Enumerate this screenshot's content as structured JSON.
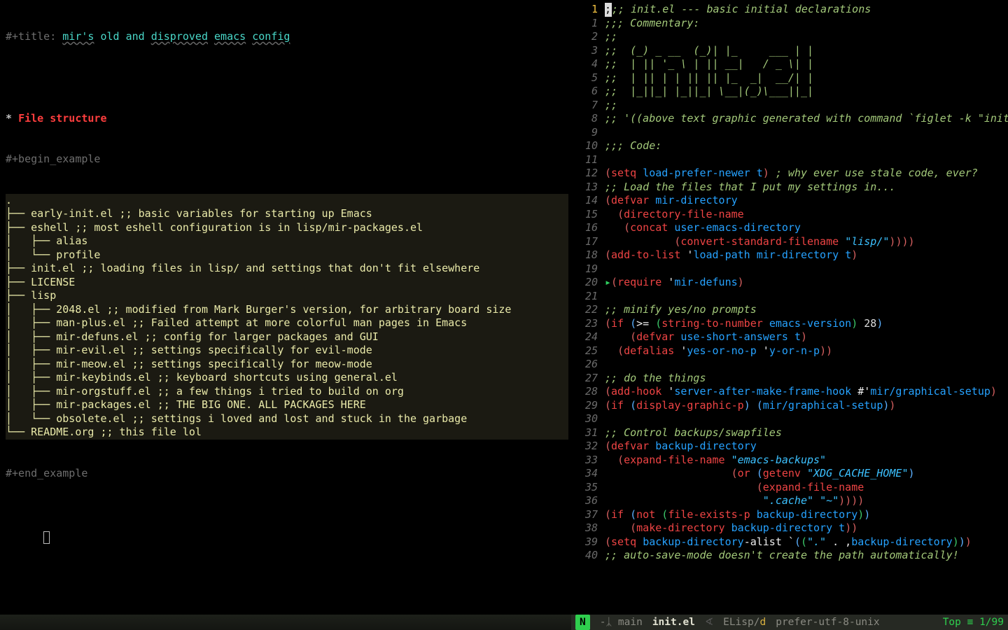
{
  "left": {
    "title_prefix": "#+title: ",
    "title_words": [
      "mir's",
      "old",
      "and",
      "disproved",
      "emacs",
      "config"
    ],
    "heading_star": "* ",
    "heading_text": "File structure",
    "begin_example": "#+begin_example",
    "end_example": "#+end_example",
    "tree": [
      ".",
      "├── early-init.el ;; basic variables for starting up Emacs",
      "├── eshell ;; most eshell configuration is in lisp/mir-packages.el",
      "│   ├── alias",
      "│   └── profile",
      "├── init.el ;; loading files in lisp/ and settings that don't fit elsewhere",
      "├── LICENSE",
      "├── lisp",
      "│   ├── 2048.el ;; modified from Mark Burger's version, for arbitrary board size",
      "│   ├── man-plus.el ;; Failed attempt at more colorful man pages in Emacs",
      "│   ├── mir-defuns.el ;; config for larger packages and GUI",
      "│   ├── mir-evil.el ;; settings specifically for evil-mode",
      "│   ├── mir-meow.el ;; settings specifically for meow-mode",
      "│   ├── mir-keybinds.el ;; keyboard shortcuts using general.el",
      "│   ├── mir-orgstuff.el ;; a few things i tried to build on org",
      "│   ├── mir-packages.el ;; THE BIG ONE. ALL PACKAGES HERE",
      "│   └── obsolete.el ;; settings i loved and lost and stuck in the garbage",
      "└── README.org ;; this file lol"
    ]
  },
  "right": {
    "current_line_indicator": "1",
    "lines": [
      {
        "n": 1,
        "raw": ";;; init.el --- basic initial declarations",
        "cls": "cm1"
      },
      {
        "n": 1,
        "raw": ";;; Commentary:",
        "cls": "cm"
      },
      {
        "n": 2,
        "raw": ";;",
        "cls": "cm"
      },
      {
        "n": 3,
        "raw": ";;  (_) _ __  (_)| |_     ___ | |",
        "cls": "cm"
      },
      {
        "n": 4,
        "raw": ";;  | || '_ \\ | || __|   / _ \\| |",
        "cls": "cm"
      },
      {
        "n": 5,
        "raw": ";;  | || | | || || |_  _|  __/| |",
        "cls": "cm"
      },
      {
        "n": 6,
        "raw": ";;  |_||_| |_||_| \\__|(_)\\___||_|",
        "cls": "cm"
      },
      {
        "n": 7,
        "raw": ";;",
        "cls": "cm"
      },
      {
        "n": 8,
        "raw": ";; '((above text graphic generated with command `figlet -k \"init.el\"'))",
        "cls": "cm"
      },
      {
        "n": 9,
        "raw": "",
        "cls": ""
      },
      {
        "n": 10,
        "raw": ";;; Code:",
        "cls": "cm"
      },
      {
        "n": 11,
        "raw": "",
        "cls": ""
      },
      {
        "n": 12,
        "raw": "(setq load-prefer-newer t) ; why ever use stale code, ever?",
        "cls": "code"
      },
      {
        "n": 13,
        "raw": ";; Load the files that I put my settings in...",
        "cls": "cm"
      },
      {
        "n": 14,
        "raw": "(defvar mir-directory",
        "cls": "code"
      },
      {
        "n": 15,
        "raw": "  (directory-file-name",
        "cls": "code"
      },
      {
        "n": 16,
        "raw": "   (concat user-emacs-directory",
        "cls": "code"
      },
      {
        "n": 17,
        "raw": "           (convert-standard-filename \"lisp/\"))))",
        "cls": "code"
      },
      {
        "n": 18,
        "raw": "(add-to-list 'load-path mir-directory t)",
        "cls": "code"
      },
      {
        "n": 19,
        "raw": "",
        "cls": ""
      },
      {
        "n": 20,
        "raw": "(require 'mir-defuns)",
        "cls": "code",
        "fringe": true
      },
      {
        "n": 21,
        "raw": "",
        "cls": ""
      },
      {
        "n": 22,
        "raw": ";; minify yes/no prompts",
        "cls": "cm"
      },
      {
        "n": 23,
        "raw": "(if (>= (string-to-number emacs-version) 28)",
        "cls": "code"
      },
      {
        "n": 24,
        "raw": "    (defvar use-short-answers t)",
        "cls": "code"
      },
      {
        "n": 25,
        "raw": "  (defalias 'yes-or-no-p 'y-or-n-p))",
        "cls": "code"
      },
      {
        "n": 26,
        "raw": "",
        "cls": ""
      },
      {
        "n": 27,
        "raw": ";; do the things",
        "cls": "cm"
      },
      {
        "n": 28,
        "raw": "(add-hook 'server-after-make-frame-hook #'mir/graphical-setup)",
        "cls": "code"
      },
      {
        "n": 29,
        "raw": "(if (display-graphic-p) (mir/graphical-setup))",
        "cls": "code"
      },
      {
        "n": 30,
        "raw": "",
        "cls": ""
      },
      {
        "n": 31,
        "raw": ";; Control backups/swapfiles",
        "cls": "cm"
      },
      {
        "n": 32,
        "raw": "(defvar backup-directory",
        "cls": "code"
      },
      {
        "n": 33,
        "raw": "  (expand-file-name \"emacs-backups\"",
        "cls": "code"
      },
      {
        "n": 34,
        "raw": "                    (or (getenv \"XDG_CACHE_HOME\")",
        "cls": "code"
      },
      {
        "n": 35,
        "raw": "                        (expand-file-name",
        "cls": "code"
      },
      {
        "n": 36,
        "raw": "                         \".cache\" \"~\"))))",
        "cls": "code"
      },
      {
        "n": 37,
        "raw": "(if (not (file-exists-p backup-directory))",
        "cls": "code"
      },
      {
        "n": 38,
        "raw": "    (make-directory backup-directory t))",
        "cls": "code"
      },
      {
        "n": 39,
        "raw": "(setq backup-directory-alist `((\".\" . ,backup-directory)))",
        "cls": "code"
      },
      {
        "n": 40,
        "raw": ";; auto-save-mode doesn't create the path automatically!",
        "cls": "cm"
      }
    ]
  },
  "modeline": {
    "state": "N",
    "vcs_icon": "-ᛣ",
    "branch": "main",
    "file": "init.el",
    "chev": "∢",
    "mode_pre": "ELisp/",
    "mode_suf": "d",
    "encoding": "prefer-utf-8-unix",
    "pos_label": "Top ≡ ",
    "pos_value": "1/99"
  }
}
